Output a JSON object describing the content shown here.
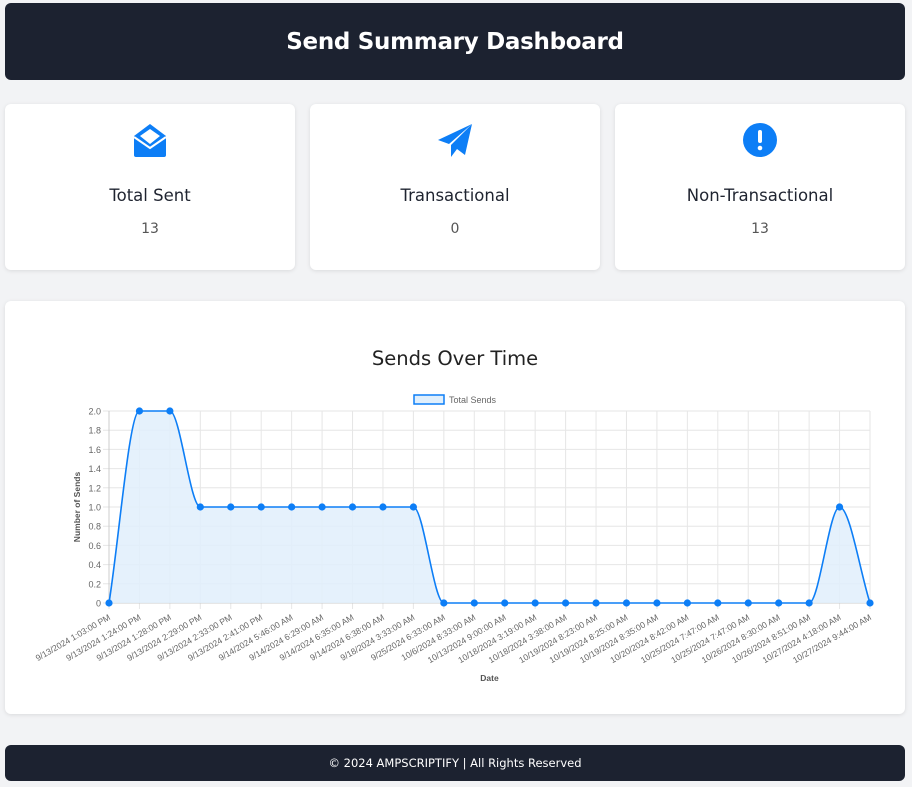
{
  "header": {
    "title": "Send Summary Dashboard"
  },
  "cards": [
    {
      "label": "Total Sent",
      "value": "13",
      "icon": "envelope-open-icon"
    },
    {
      "label": "Transactional",
      "value": "0",
      "icon": "paper-plane-icon"
    },
    {
      "label": "Non-Transactional",
      "value": "13",
      "icon": "exclamation-circle-icon"
    }
  ],
  "colors": {
    "accent": "#0d7ef6",
    "header_bg": "#1c2230",
    "area_fill": "#e0effc"
  },
  "chart": {
    "title": "Sends Over Time"
  },
  "chart_data": {
    "type": "line",
    "title": "",
    "xlabel": "Date",
    "ylabel": "Number of Sends",
    "ylim": [
      0,
      2
    ],
    "yticks": [
      "0",
      "0.2",
      "0.4",
      "0.6",
      "0.8",
      "1.0",
      "1.2",
      "1.4",
      "1.6",
      "1.8",
      "2.0"
    ],
    "grid": true,
    "legend_position": "top",
    "x": [
      "9/13/2024 1:03:00 PM",
      "9/13/2024 1:24:00 PM",
      "9/13/2024 1:28:00 PM",
      "9/13/2024 2:29:00 PM",
      "9/13/2024 2:33:00 PM",
      "9/13/2024 2:41:00 PM",
      "9/14/2024 5:46:00 AM",
      "9/14/2024 6:29:00 AM",
      "9/14/2024 6:35:00 AM",
      "9/14/2024 6:38:00 AM",
      "9/18/2024 3:33:00 AM",
      "9/25/2024 6:33:00 AM",
      "10/6/2024 8:33:00 AM",
      "10/13/2024 9:00:00 AM",
      "10/18/2024 3:19:00 AM",
      "10/18/2024 3:38:00 AM",
      "10/19/2024 8:23:00 AM",
      "10/19/2024 8:25:00 AM",
      "10/19/2024 8:35:00 AM",
      "10/20/2024 8:42:00 AM",
      "10/25/2024 7:47:00 AM",
      "10/25/2024 7:47:00 AM",
      "10/26/2024 8:30:00 AM",
      "10/26/2024 8:51:00 AM",
      "10/27/2024 4:18:00 AM",
      "10/27/2024 9:44:00 AM"
    ],
    "series": [
      {
        "name": "Total Sends",
        "values": [
          0,
          2,
          2,
          1,
          1,
          1,
          1,
          1,
          1,
          1,
          1,
          0,
          0,
          0,
          0,
          0,
          0,
          0,
          0,
          0,
          0,
          0,
          0,
          0,
          1,
          0
        ]
      }
    ]
  },
  "footer": {
    "text": "© 2024 AMPSCRIPTIFY | All Rights Reserved"
  }
}
